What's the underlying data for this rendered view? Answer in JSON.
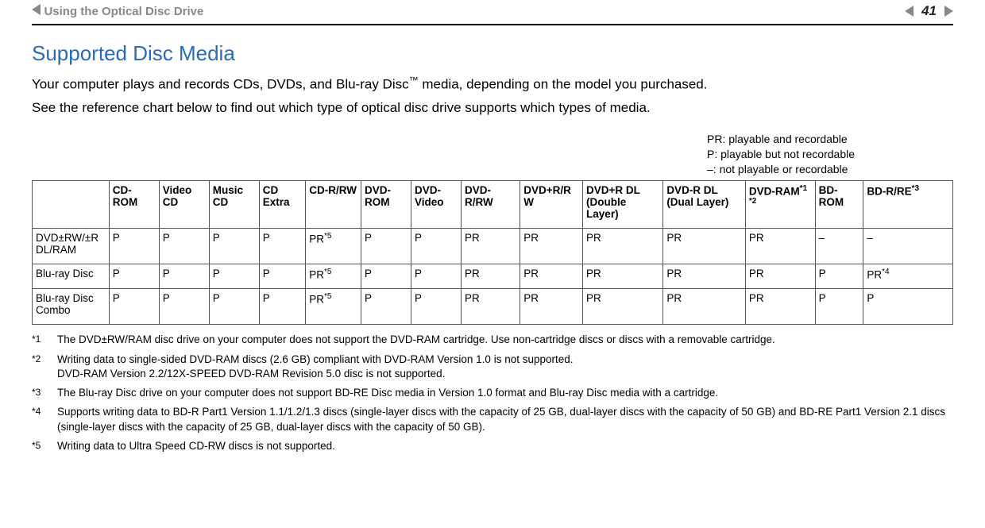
{
  "header": {
    "breadcrumb": "Using the Optical Disc Drive",
    "page_number": "41"
  },
  "title": "Supported Disc Media",
  "paragraphs": {
    "p1a": "Your computer plays and records CDs, DVDs, and Blu-ray Disc",
    "p1b": " media, depending on the model you purchased.",
    "tm": "™",
    "p2": "See the reference chart below to find out which type of optical disc drive supports which types of media."
  },
  "legend": {
    "l1": "PR: playable and recordable",
    "l2": "P: playable but not recordable",
    "l3": "–: not playable or recordable"
  },
  "table": {
    "headers": {
      "h1": "CD-ROM",
      "h2": "Video CD",
      "h3": "Music CD",
      "h4": "CD Extra",
      "h5": "CD-R/RW",
      "h6": "DVD-ROM",
      "h7": "DVD-Video",
      "h8": "DVD-R/RW",
      "h9": "DVD+R/RW",
      "h10": "DVD+R DL (Double Layer)",
      "h11": "DVD-R DL (Dual Layer)",
      "h12a": "DVD-RAM",
      "h12sup": "*1 *2",
      "h13": "BD-ROM",
      "h14a": "BD-R/RE",
      "h14sup": "*3"
    },
    "rows": {
      "r1": {
        "name": "DVD±RW/±R DL/RAM",
        "c": [
          "P",
          "P",
          "P",
          "P"
        ],
        "c5a": "PR",
        "c5sup": "*5",
        "d": [
          "P",
          "P",
          "PR",
          "PR",
          "PR",
          "PR",
          "PR",
          "–",
          "–"
        ]
      },
      "r2": {
        "name": "Blu-ray Disc",
        "c": [
          "P",
          "P",
          "P",
          "P"
        ],
        "c5a": "PR",
        "c5sup": "*5",
        "d": [
          "P",
          "P",
          "PR",
          "PR",
          "PR",
          "PR",
          "PR",
          "P"
        ],
        "lastA": "PR",
        "lastSup": "*4"
      },
      "r3": {
        "name": "Blu-ray Disc Combo",
        "c": [
          "P",
          "P",
          "P",
          "P"
        ],
        "c5a": "PR",
        "c5sup": "*5",
        "d": [
          "P",
          "P",
          "PR",
          "PR",
          "PR",
          "PR",
          "PR",
          "P",
          "P"
        ]
      }
    }
  },
  "footnotes": {
    "f1": {
      "mk": "*1",
      "txt": "The DVD±RW/RAM disc drive on your computer does not support the DVD-RAM cartridge. Use non-cartridge discs or discs with a removable cartridge."
    },
    "f2": {
      "mk": "*2",
      "txt": "Writing data to single-sided DVD-RAM discs (2.6 GB) compliant with DVD-RAM Version 1.0 is not supported.\nDVD-RAM Version 2.2/12X-SPEED DVD-RAM Revision 5.0 disc is not supported."
    },
    "f3": {
      "mk": "*3",
      "txt": "The Blu-ray Disc drive on your computer does not support BD-RE Disc media in Version 1.0 format and Blu-ray Disc media with a cartridge."
    },
    "f4": {
      "mk": "*4",
      "txt": "Supports writing data to BD-R Part1 Version 1.1/1.2/1.3 discs (single-layer discs with the capacity of 25 GB, dual-layer discs with the capacity of 50 GB) and BD-RE Part1 Version 2.1 discs (single-layer discs with the capacity of 25 GB, dual-layer discs with the capacity of 50 GB)."
    },
    "f5": {
      "mk": "*5",
      "txt": "Writing data to Ultra Speed CD-RW discs is not supported."
    }
  }
}
